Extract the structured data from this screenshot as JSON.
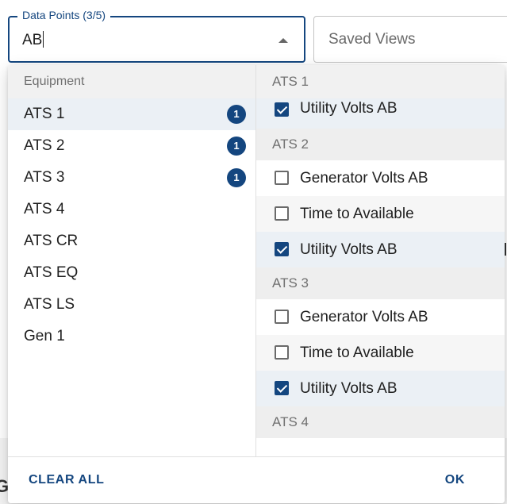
{
  "data_points_field": {
    "label": "Data Points (3/5)",
    "value": "AB"
  },
  "saved_views": {
    "placeholder": "Saved Views"
  },
  "equipment": {
    "header": "Equipment",
    "items": [
      {
        "label": "ATS 1",
        "count": "1",
        "selected": true
      },
      {
        "label": "ATS 2",
        "count": "1"
      },
      {
        "label": "ATS 3",
        "count": "1"
      },
      {
        "label": "ATS 4"
      },
      {
        "label": "ATS CR"
      },
      {
        "label": "ATS EQ"
      },
      {
        "label": "ATS LS"
      },
      {
        "label": "Gen 1"
      }
    ]
  },
  "points": {
    "groups": [
      {
        "name": "ATS 1",
        "items": [
          {
            "label": "Utility Volts AB",
            "checked": true
          }
        ]
      },
      {
        "name": "ATS 2",
        "items": [
          {
            "label": "Generator Volts AB",
            "checked": false
          },
          {
            "label": "Time to Available",
            "checked": false
          },
          {
            "label": "Utility Volts AB",
            "checked": true
          }
        ]
      },
      {
        "name": "ATS 3",
        "items": [
          {
            "label": "Generator Volts AB",
            "checked": false
          },
          {
            "label": "Time to Available",
            "checked": false
          },
          {
            "label": "Utility Volts AB",
            "checked": true
          }
        ]
      },
      {
        "name": "ATS 4",
        "items": []
      }
    ]
  },
  "footer": {
    "clear_all": "CLEAR ALL",
    "ok": "OK"
  },
  "colors": {
    "accent": "#14467f",
    "selected_row": "#ebf0f5",
    "group_header_bg": "#eeeeee"
  }
}
